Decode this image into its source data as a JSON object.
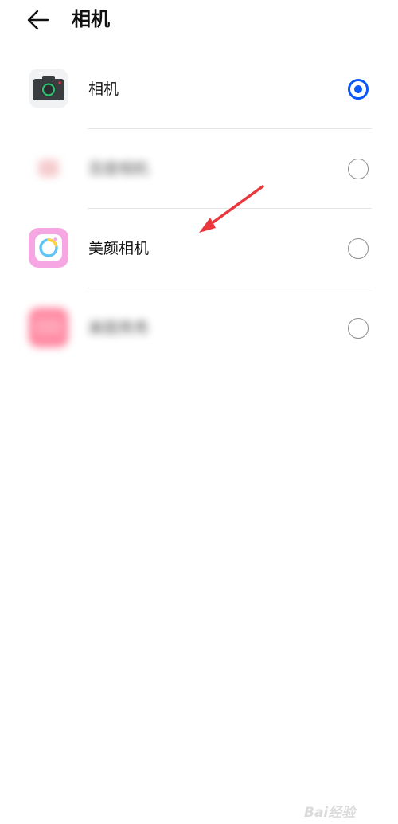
{
  "header": {
    "back_icon": "arrow-left-icon",
    "title": "相机"
  },
  "apps": [
    {
      "label": "相机",
      "icon": "camera-app-icon",
      "selected": true,
      "blurred": false
    },
    {
      "label": "百度相机",
      "icon": "blurred-app-icon",
      "selected": false,
      "blurred": true
    },
    {
      "label": "美颜相机",
      "icon": "beauty-camera-app-icon",
      "selected": false,
      "blurred": false
    },
    {
      "label": "美图秀秀",
      "icon": "blurred-app-icon",
      "selected": false,
      "blurred": true
    }
  ],
  "colors": {
    "accent": "#0a59f7",
    "annotation": "#e8383d",
    "beauty_icon_bg": "#f7a6e4",
    "camera_body": "#3a3d40",
    "camera_lens": "#2fbf71"
  },
  "watermark": {
    "text": "Bai经验"
  }
}
